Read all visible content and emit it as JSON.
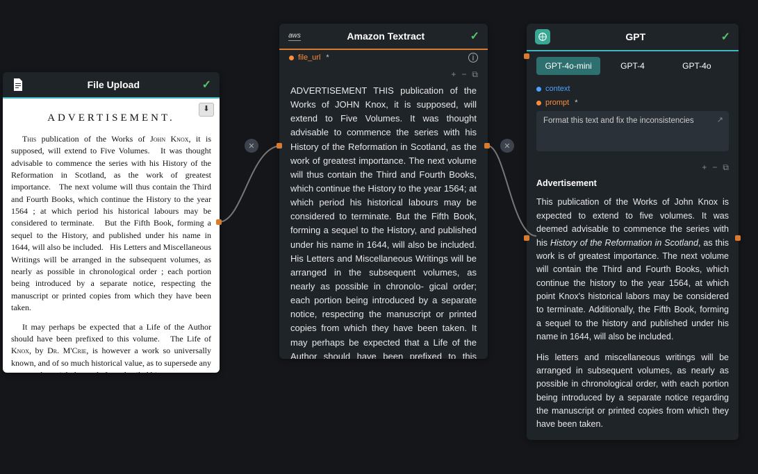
{
  "nodes": {
    "file_upload": {
      "title": "File Upload",
      "doc": {
        "heading": "ADVERTISEMENT.",
        "p1": "This publication of the Works of John Knox, it is supposed, will extend to Five Volumes.   It was thought advisable to commence the series with his History of the Reformation in Scotland, as the work of greatest importance.   The next volume will thus contain the Third and Fourth Books, which continue the History to the year 1564 ; at which period his historical labours may be considered to terminate.   But the Fifth Book, forming a sequel to the History, and published under his name in 1644, will also be included.   His Letters and Miscellaneous Writings will be arranged in the subsequent volumes, as nearly as possible in chronological order ; each portion being introduced by a separate notice, respecting the manuscript or printed copies from which they have been taken.",
        "p2": "It may perhaps be expected that a Life of the Author should have been prefixed to this volume.   The Life of Knox, by Dr. M'Crie, is however a work so universally known, and of so much historical value, as to supersede any attempt that might be made for a detailed bio-"
      }
    },
    "textract": {
      "title": "Amazon Textract",
      "field": "file_url",
      "output": "ADVERTISEMENT THIS publication of the Works of JOHN Knox, it is supposed, will extend to Five Volumes. It was thought advisable to commence the series with his History of the Reformation in Scotland, as the work of greatest importance. The next volume will thus contain the Third and Fourth Books, which continue the History to the year 1564; at which period his historical labours may be considered to terminate. But the Fifth Book, forming a sequel to the History, and published under his name in 1644, will also be included. His Letters and Miscellaneous Writings will be arranged in the subsequent volumes, as nearly as possible in chronolo- gical order; each portion being introduced by a separate notice, respecting the manuscript or printed copies from which they have been taken. It may perhaps be expected that a Life of the Author should have been prefixed to this volume. The Life of Knox, by DR. M'CRIE. is however a work SO universally"
    },
    "gpt": {
      "title": "GPT",
      "tabs": [
        "GPT-4o-mini",
        "GPT-4",
        "GPT-4o"
      ],
      "active_tab": 0,
      "fields": {
        "context": "context",
        "prompt": "prompt"
      },
      "prompt_value": "Format this text and fix the inconsistencies",
      "output": {
        "heading": "Advertisement",
        "p1a": "This publication of the Works of John Knox is expected to extend to five volumes. It was deemed advisable to commence the series with his ",
        "p1_em": "History of the Reformation in Scotland",
        "p1b": ", as this work is of greatest importance. The next volume will contain the Third and Fourth Books, which continue the history to the year 1564, at which point Knox's historical labors may be considered to terminate. Additionally, the Fifth Book, forming a sequel to the history and published under his name in 1644, will also be included.",
        "p2": "His letters and miscellaneous writings will be arranged in subsequent volumes, as nearly as possible in chronological order, with each portion being introduced by a separate notice regarding the manuscript or printed copies from which they have been taken."
      }
    }
  },
  "icons": {
    "plus": "+",
    "minus": "−",
    "copy": "⧉",
    "download": "⬇",
    "close": "✕",
    "external": "↗",
    "check": "✓"
  }
}
